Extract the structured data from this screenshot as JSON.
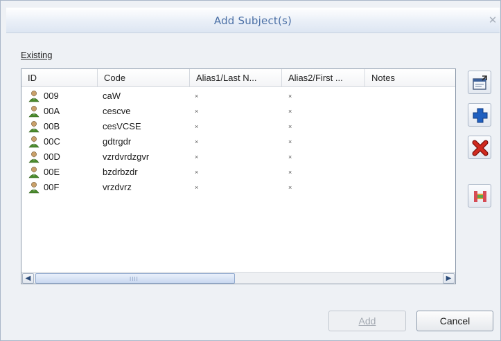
{
  "dialog": {
    "title": "Add Subject(s)",
    "close_glyph": "✕"
  },
  "group_label": "Existing",
  "table": {
    "columns": [
      "ID",
      "Code",
      "Alias1/Last N...",
      "Alias2/First ...",
      "Notes"
    ],
    "rows": [
      {
        "id": "009",
        "code": "caW",
        "alias1": "×",
        "alias2": "×"
      },
      {
        "id": "00A",
        "code": "cescve",
        "alias1": "×",
        "alias2": "×"
      },
      {
        "id": "00B",
        "code": "cesVCSE",
        "alias1": "×",
        "alias2": "×"
      },
      {
        "id": "00C",
        "code": "gdtrgdr",
        "alias1": "×",
        "alias2": "×"
      },
      {
        "id": "00D",
        "code": "vzrdvrdzgvr",
        "alias1": "×",
        "alias2": "×"
      },
      {
        "id": "00E",
        "code": "bzdrbzdr",
        "alias1": "×",
        "alias2": "×"
      },
      {
        "id": "00F",
        "code": "vrzdvrz",
        "alias1": "×",
        "alias2": "×"
      }
    ]
  },
  "scrollbar": {
    "left_glyph": "◀",
    "right_glyph": "▶",
    "grip": "IIII"
  },
  "side_buttons": [
    "properties-icon",
    "add-icon",
    "delete-icon",
    "merge-icon"
  ],
  "buttons": {
    "add": "Add",
    "cancel": "Cancel"
  },
  "colors": {
    "title": "#4a6fa5",
    "add_icon": "#1f5fbf",
    "delete_icon": "#c0201a"
  }
}
